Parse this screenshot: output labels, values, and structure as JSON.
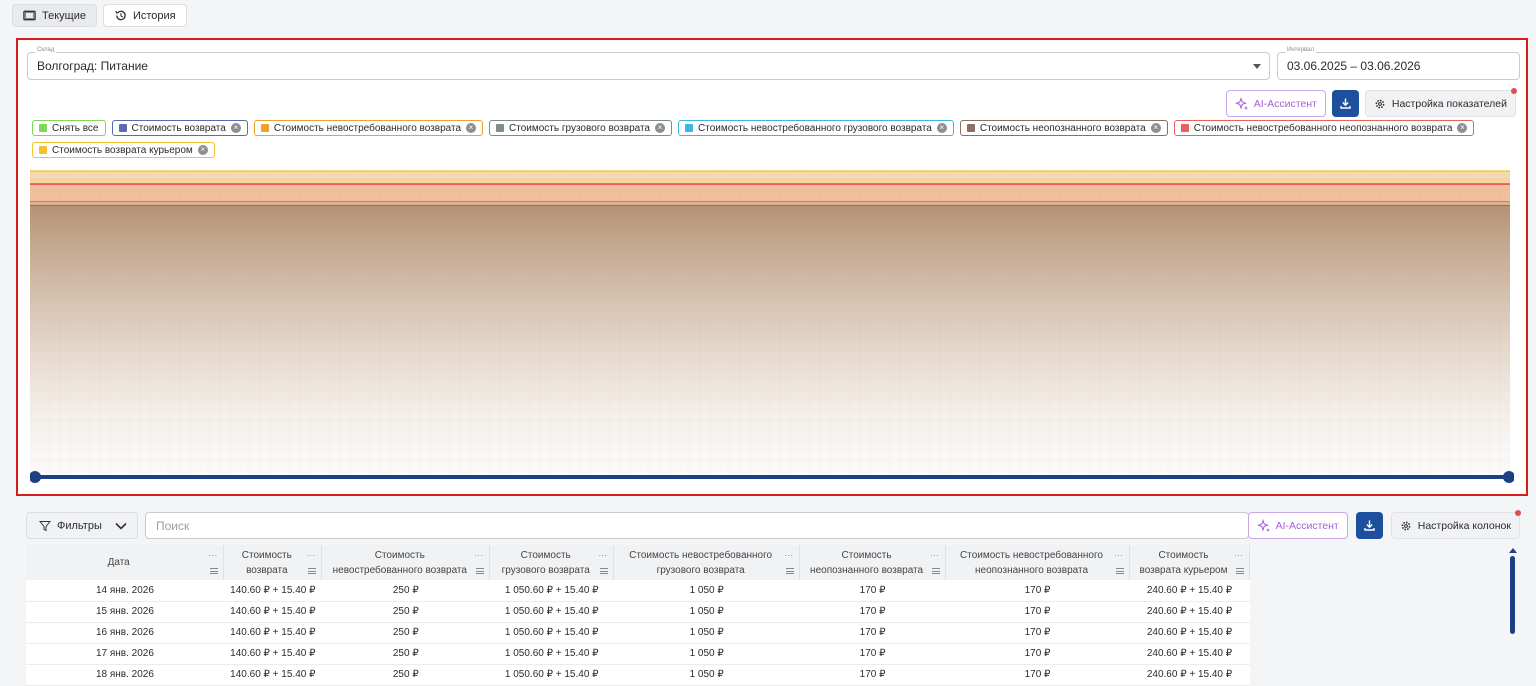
{
  "tabs": [
    {
      "label": "Текущие",
      "icon": "window-icon",
      "active": true
    },
    {
      "label": "История",
      "icon": "history-icon",
      "active": false
    }
  ],
  "warehouse": {
    "label": "Склад",
    "value": "Волгоград: Питание"
  },
  "interval": {
    "label": "Интервал",
    "value": "03.06.2025 – 03.06.2026"
  },
  "chart_actions": {
    "ai_label": "AI-Ассистент",
    "settings_label": "Настройка показателей"
  },
  "legend": [
    {
      "label": "Снять все",
      "color": "#7ed957",
      "removable": false
    },
    {
      "label": "Стоимость возврата",
      "color": "#5b6bb0",
      "removable": true
    },
    {
      "label": "Стоимость невостребованного возврата",
      "color": "#f0a030",
      "removable": true
    },
    {
      "label": "Стоимость грузового возврата",
      "color": "#7f8c8d",
      "removable": true
    },
    {
      "label": "Стоимость невостребованного грузового возврата",
      "color": "#3bb6e0",
      "removable": true
    },
    {
      "label": "Стоимость неопознанного возврата",
      "color": "#8d6e63",
      "removable": true
    },
    {
      "label": "Стоимость невостребованного неопознанного возврата",
      "color": "#e8605a",
      "removable": true
    },
    {
      "label": "Стоимость возврата курьером",
      "color": "#f2c230",
      "removable": true
    }
  ],
  "chart_data": {
    "type": "area",
    "series": [
      {
        "name": "Стоимость возврата",
        "color": "#5b6bb0"
      },
      {
        "name": "Стоимость невостребованного возврата",
        "color": "#f0a030"
      },
      {
        "name": "Стоимость грузового возврата",
        "color": "#7f8c8d"
      },
      {
        "name": "Стоимость невостребованного грузового возврата",
        "color": "#3bb6e0"
      },
      {
        "name": "Стоимость неопознанного возврата",
        "color": "#8d6e63"
      },
      {
        "name": "Стоимость невостребованного неопознанного возврата",
        "color": "#e8605a"
      },
      {
        "name": "Стоимость возврата курьером",
        "color": "#f2c230"
      }
    ],
    "grid": true,
    "range_slider": {
      "start": 0,
      "end": 1,
      "color": "#1d3f85"
    }
  },
  "table_controls": {
    "filters_label": "Фильтры",
    "search_placeholder": "Поиск",
    "ai_label": "AI-Ассистент",
    "columns_label": "Настройка колонок"
  },
  "table": {
    "columns": [
      [
        "Дата"
      ],
      [
        "Стоимость",
        "возврата"
      ],
      [
        "Стоимость",
        "невостребованного возврата"
      ],
      [
        "Стоимость",
        "грузового возврата"
      ],
      [
        "Стоимость невостребованного",
        "грузового возврата"
      ],
      [
        "Стоимость",
        "неопознанного возврата"
      ],
      [
        "Стоимость невостребованного",
        "неопознанного возврата"
      ],
      [
        "Стоимость",
        "возврата курьером"
      ]
    ],
    "rows": [
      [
        "14 янв. 2026",
        "140.60 ₽ + 15.40 ₽",
        "250 ₽",
        "1 050.60 ₽ + 15.40 ₽",
        "1 050 ₽",
        "170 ₽",
        "170 ₽",
        "240.60 ₽ + 15.40 ₽"
      ],
      [
        "15 янв. 2026",
        "140.60 ₽ + 15.40 ₽",
        "250 ₽",
        "1 050.60 ₽ + 15.40 ₽",
        "1 050 ₽",
        "170 ₽",
        "170 ₽",
        "240.60 ₽ + 15.40 ₽"
      ],
      [
        "16 янв. 2026",
        "140.60 ₽ + 15.40 ₽",
        "250 ₽",
        "1 050.60 ₽ + 15.40 ₽",
        "1 050 ₽",
        "170 ₽",
        "170 ₽",
        "240.60 ₽ + 15.40 ₽"
      ],
      [
        "17 янв. 2026",
        "140.60 ₽ + 15.40 ₽",
        "250 ₽",
        "1 050.60 ₽ + 15.40 ₽",
        "1 050 ₽",
        "170 ₽",
        "170 ₽",
        "240.60 ₽ + 15.40 ₽"
      ],
      [
        "18 янв. 2026",
        "140.60 ₽ + 15.40 ₽",
        "250 ₽",
        "1 050.60 ₽ + 15.40 ₽",
        "1 050 ₽",
        "170 ₽",
        "170 ₽",
        "240.60 ₽ + 15.40 ₽"
      ]
    ]
  }
}
